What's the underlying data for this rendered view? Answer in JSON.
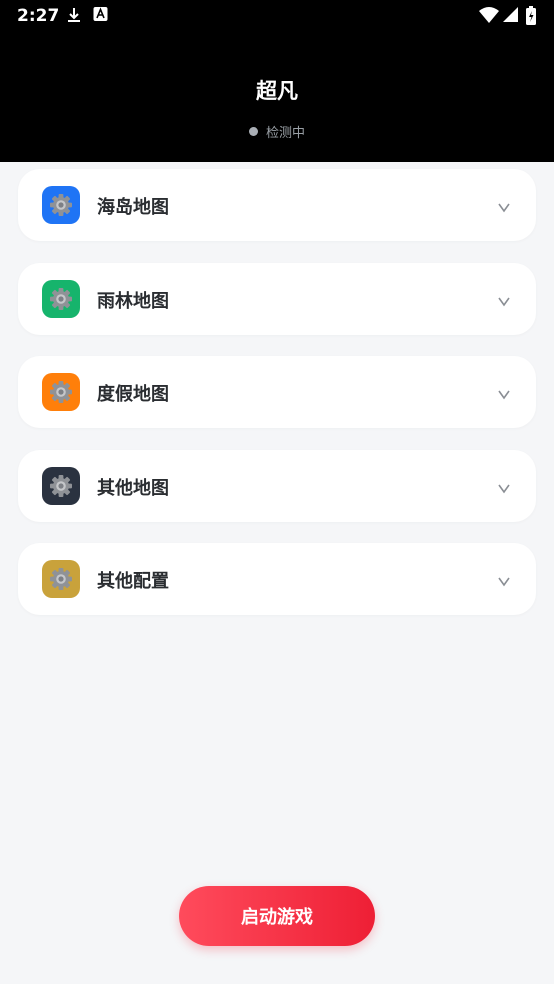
{
  "status_bar": {
    "time": "2:27",
    "icons": [
      "download-icon",
      "a-icon",
      "wifi-icon",
      "signal-icon",
      "battery-icon"
    ]
  },
  "header": {
    "title": "超凡",
    "status_text": "检测中"
  },
  "sections": [
    {
      "label": "海岛地图",
      "icon_color": "#1f74f5",
      "icon": "gear-icon"
    },
    {
      "label": "雨林地图",
      "icon_color": "#16b46c",
      "icon": "gear-icon"
    },
    {
      "label": "度假地图",
      "icon_color": "#ff7f0a",
      "icon": "gear-icon"
    },
    {
      "label": "其他地图",
      "icon_color": "#2a3240",
      "icon": "gear-icon"
    },
    {
      "label": "其他配置",
      "icon_color": "#c9a23b",
      "icon": "gear-icon"
    }
  ],
  "start_button": {
    "label": "启动游戏",
    "gradient": [
      "#ff4b5c",
      "#ee1f35"
    ]
  }
}
